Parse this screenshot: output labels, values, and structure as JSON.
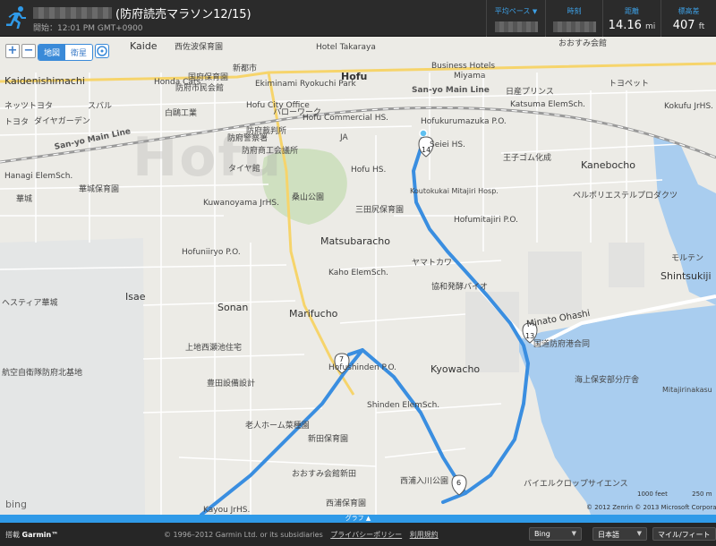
{
  "header": {
    "title": "(防府読売マラソン12/15)",
    "subtitle": "開始：12:01 PM GMT+0900",
    "stats": [
      {
        "label": "平均ペース",
        "value": "",
        "unit": "",
        "has_dropdown": true
      },
      {
        "label": "時刻",
        "value": "",
        "unit": ""
      },
      {
        "label": "距離",
        "value": "14.16",
        "unit": "mi"
      },
      {
        "label": "標高差",
        "value": "407",
        "unit": "ft"
      }
    ]
  },
  "map_controls": {
    "zoom_in": "+",
    "zoom_out": "−",
    "map_type": [
      "地図",
      "衛星"
    ],
    "active_type": "地図"
  },
  "map": {
    "watermark": "Hofu",
    "labels": [
      {
        "text": "Kaide"
      },
      {
        "text": "Kaidenishimachi"
      },
      {
        "text": "Hofu"
      },
      {
        "text": "Matsubaracho"
      },
      {
        "text": "Sonan"
      },
      {
        "text": "Marifucho"
      },
      {
        "text": "Kyowacho"
      },
      {
        "text": "Isae"
      },
      {
        "text": "Kanebocho"
      },
      {
        "text": "Shintsukiji"
      },
      {
        "text": "San-yo Main Line"
      },
      {
        "text": "San-yo Main Line"
      },
      {
        "text": "Minato Ohashi"
      },
      {
        "text": "Hotel Takaraya"
      },
      {
        "text": "Business Hotels"
      },
      {
        "text": "Miyama"
      },
      {
        "text": "Hofu City Office"
      },
      {
        "text": "Hofu Commercial HS."
      },
      {
        "text": "Hofukurumazuka P.O."
      },
      {
        "text": "Seiei HS."
      },
      {
        "text": "Hofu HS."
      },
      {
        "text": "Hofumitajiri P.O."
      },
      {
        "text": "Kaho ElemSch."
      },
      {
        "text": "Hofuniiryo P.O."
      },
      {
        "text": "Kuwanoyama JrHS."
      },
      {
        "text": "Shinden ElemSch."
      },
      {
        "text": "Hofushinden P.O."
      },
      {
        "text": "Hanagi ElemSch."
      },
      {
        "text": "Katsuma ElemSch."
      },
      {
        "text": "Kayou JrHS."
      },
      {
        "text": "Kokufu JrHS."
      },
      {
        "text": "Mitajirinakasu"
      },
      {
        "text": "Koutokukai Mitajiri Hosp."
      },
      {
        "text": "ヤマトカワ"
      },
      {
        "text": "協和発酵バイオ"
      },
      {
        "text": "三田尻保育園"
      },
      {
        "text": "ハローワーク"
      },
      {
        "text": "防府裁判所"
      },
      {
        "text": "タイヤ館"
      },
      {
        "text": "桑山公園"
      },
      {
        "text": "王子ゴム化成"
      },
      {
        "text": "ペルポリエステルプロダクツ"
      },
      {
        "text": "モルテン"
      },
      {
        "text": "日産プリンス"
      },
      {
        "text": "トヨペット"
      },
      {
        "text": "おおすみ会館"
      },
      {
        "text": "新田保育園"
      },
      {
        "text": "おおすみ会館新田"
      },
      {
        "text": "西浦保育園"
      },
      {
        "text": "老人ホーム菜種園"
      },
      {
        "text": "豊田設備設計"
      },
      {
        "text": "上地西瀬池住宅"
      },
      {
        "text": "航空自衛隊防府北基地"
      },
      {
        "text": "ヘスティア華城"
      },
      {
        "text": "バイエルクロップサイエンス"
      },
      {
        "text": "西浦入川公園"
      },
      {
        "text": "海上保安部分庁舎"
      },
      {
        "text": "国道防府港合同"
      },
      {
        "text": "ネッツトヨタ"
      },
      {
        "text": "スバル"
      },
      {
        "text": "ダイヤガーデン"
      },
      {
        "text": "トヨタ"
      },
      {
        "text": "西佐波保育園"
      },
      {
        "text": "防府商工会議所"
      },
      {
        "text": "白鷗工業"
      },
      {
        "text": "華城保育園"
      },
      {
        "text": "国府保育園"
      },
      {
        "text": "Ekiminami Ryokuchi Park"
      },
      {
        "text": "Honda Cars"
      },
      {
        "text": "防府市民会館"
      },
      {
        "text": "防府警察署"
      },
      {
        "text": "華城"
      },
      {
        "text": "JA"
      },
      {
        "text": "新都市"
      }
    ],
    "route_markers": [
      "14",
      "13",
      "7",
      "6"
    ],
    "route_color": "#3a8ee0"
  },
  "map_attribution": {
    "bing": "bing",
    "scale_ft": "1000 feet",
    "scale_m": "250 m",
    "copyright": "© 2012 Zenrin   © 2013 Microsoft Corporation"
  },
  "graph_bar": {
    "label": "グラフ ▲"
  },
  "footer": {
    "powered_prefix": "搭載",
    "powered_brand": "Garmin™",
    "copyright": "© 1996–2012 Garmin Ltd. or its subsidiaries",
    "privacy": "プライバシーポリシー",
    "terms": "利用規約",
    "map_source": "Bing",
    "language": "日本語",
    "units": "マイル/フィート"
  }
}
